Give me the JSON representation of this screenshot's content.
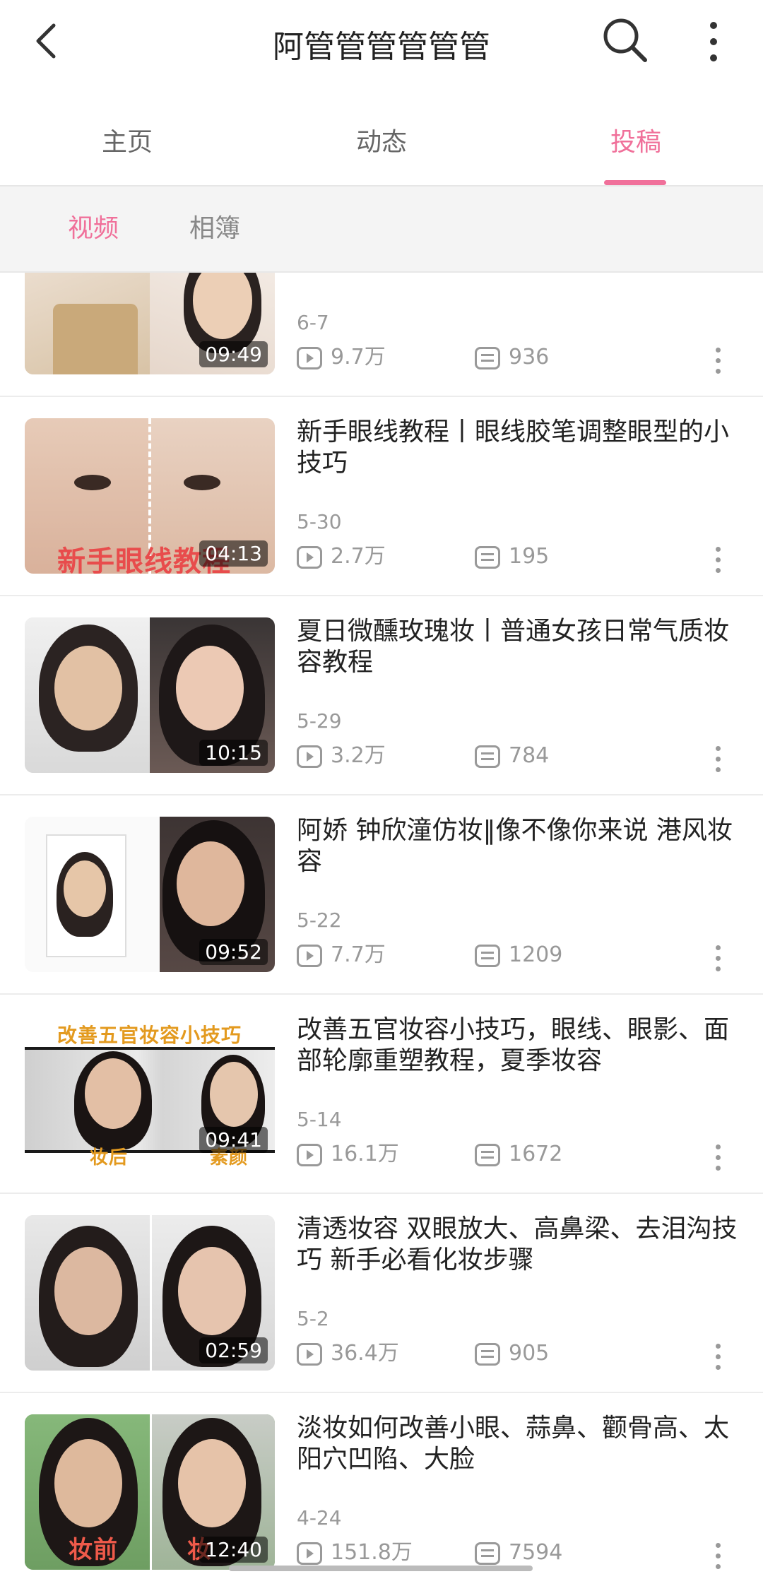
{
  "header": {
    "title": "阿管管管管管管"
  },
  "tabs": [
    {
      "label": "主页",
      "active": false
    },
    {
      "label": "动态",
      "active": false
    },
    {
      "label": "投稿",
      "active": true
    }
  ],
  "subtabs": [
    {
      "label": "视频",
      "active": true
    },
    {
      "label": "相簿",
      "active": false
    }
  ],
  "colors": {
    "accent": "#f0709a",
    "muted": "#999999"
  },
  "videos": [
    {
      "title": "",
      "date": "6-7",
      "plays": "9.7万",
      "comments": "936",
      "duration": "09:49",
      "overlay": ""
    },
    {
      "title": "新手眼线教程丨眼线胶笔调整眼型的小技巧",
      "date": "5-30",
      "plays": "2.7万",
      "comments": "195",
      "duration": "04:13",
      "overlay": "新手眼线教程"
    },
    {
      "title": "夏日微醺玫瑰妆丨普通女孩日常气质妆容教程",
      "date": "5-29",
      "plays": "3.2万",
      "comments": "784",
      "duration": "10:15",
      "overlay": ""
    },
    {
      "title": "阿娇  钟欣潼仿妆‖像不像你来说   港风妆容",
      "date": "5-22",
      "plays": "7.7万",
      "comments": "1209",
      "duration": "09:52",
      "overlay": ""
    },
    {
      "title": "改善五官妆容小技巧，眼线、眼影、面部轮廓重塑教程，夏季妆容",
      "date": "5-14",
      "plays": "16.1万",
      "comments": "1672",
      "duration": "09:41",
      "overlay": "改善五官妆容小技巧",
      "overlay2": "妆后",
      "overlay3": "素颜"
    },
    {
      "title": "清透妆容  双眼放大、高鼻梁、去泪沟技巧  新手必看化妆步骤",
      "date": "5-2",
      "plays": "36.4万",
      "comments": "905",
      "duration": "02:59",
      "overlay": ""
    },
    {
      "title": "淡妆如何改善小眼、蒜鼻、颧骨高、太阳穴凹陷、大脸",
      "date": "4-24",
      "plays": "151.8万",
      "comments": "7594",
      "duration": "12:40",
      "overlay": "妆前",
      "overlay2": "妆"
    }
  ]
}
